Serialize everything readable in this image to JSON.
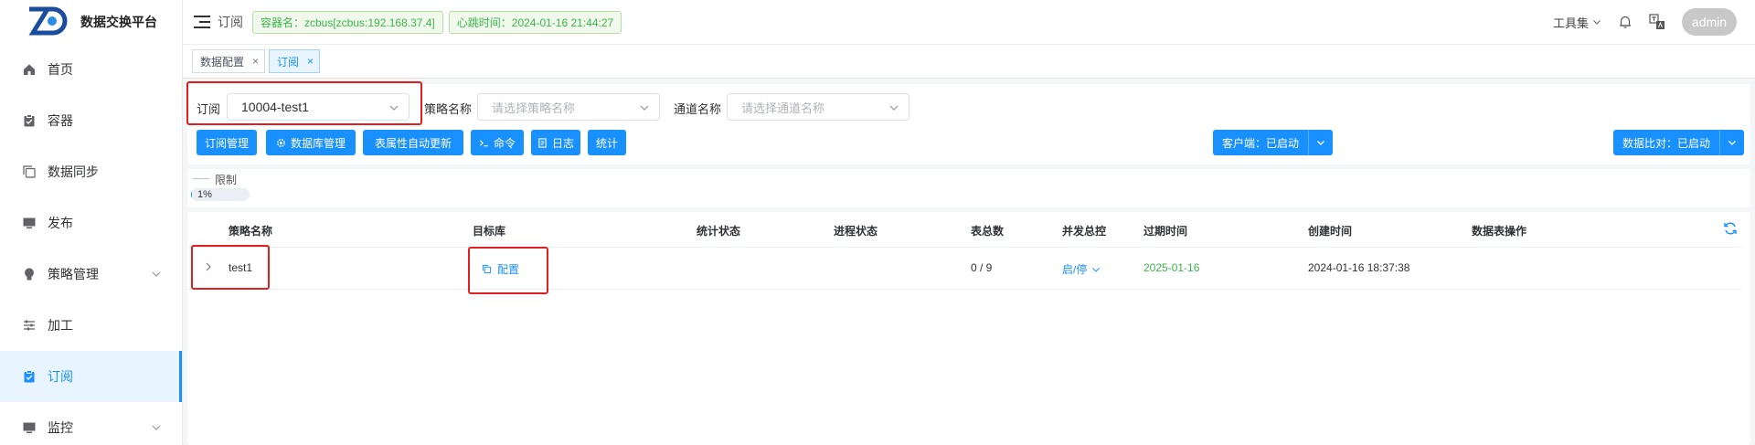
{
  "app": {
    "title": "数据交换平台",
    "logo_text": "ZD"
  },
  "sidebar": {
    "items": [
      {
        "label": "首页",
        "icon": "home-icon"
      },
      {
        "label": "容器",
        "icon": "clipboard-icon"
      },
      {
        "label": "数据同步",
        "icon": "copy-icon"
      },
      {
        "label": "发布",
        "icon": "monitor-icon"
      },
      {
        "label": "策略管理",
        "icon": "bulb-icon",
        "has_children": true
      },
      {
        "label": "加工",
        "icon": "sliders-icon"
      },
      {
        "label": "订阅",
        "icon": "clipboard-check-icon",
        "active": true
      },
      {
        "label": "监控",
        "icon": "monitor-icon",
        "has_children": true
      }
    ]
  },
  "header": {
    "breadcrumb": "订阅",
    "container_tag": "容器名：zcbus[zcbus:192.168.37.4]",
    "heartbeat_tag": "心跳时间：2024-01-16 21:44:27",
    "tools_label": "工具集",
    "user": "admin"
  },
  "tabs": [
    {
      "label": "数据配置",
      "active": false
    },
    {
      "label": "订阅",
      "active": true
    }
  ],
  "filters": {
    "subscribe_label": "订阅",
    "subscribe_value": "10004-test1",
    "strategy_label": "策略名称",
    "strategy_placeholder": "请选择策略名称",
    "channel_label": "通道名称",
    "channel_placeholder": "请选择通道名称"
  },
  "toolbar": {
    "sub_manage": "订阅管理",
    "db_manage": "数据库管理",
    "auto_update": "表属性自动更新",
    "command": "命令",
    "log": "日志",
    "stats": "统计",
    "client_status": "客户端：已启动",
    "compare_status": "数据比对：已启动"
  },
  "progress": {
    "legend": "限制",
    "percent": 1,
    "text": "1%"
  },
  "table": {
    "columns": [
      "策略名称",
      "目标库",
      "统计状态",
      "进程状态",
      "表总数",
      "并发总控",
      "过期时间",
      "创建时间",
      "数据表操作"
    ],
    "rows": [
      {
        "strategy": "test1",
        "target": "配置",
        "stat_status": "",
        "proc_status": "",
        "table_total": "0 / 9",
        "concurrency": "启/停",
        "expire": "2025-01-16",
        "created": "2024-01-16 18:37:38",
        "ops": ""
      }
    ]
  },
  "colors": {
    "primary": "#1890ff",
    "success": "#3bb54a",
    "highlight": "#e02020"
  }
}
